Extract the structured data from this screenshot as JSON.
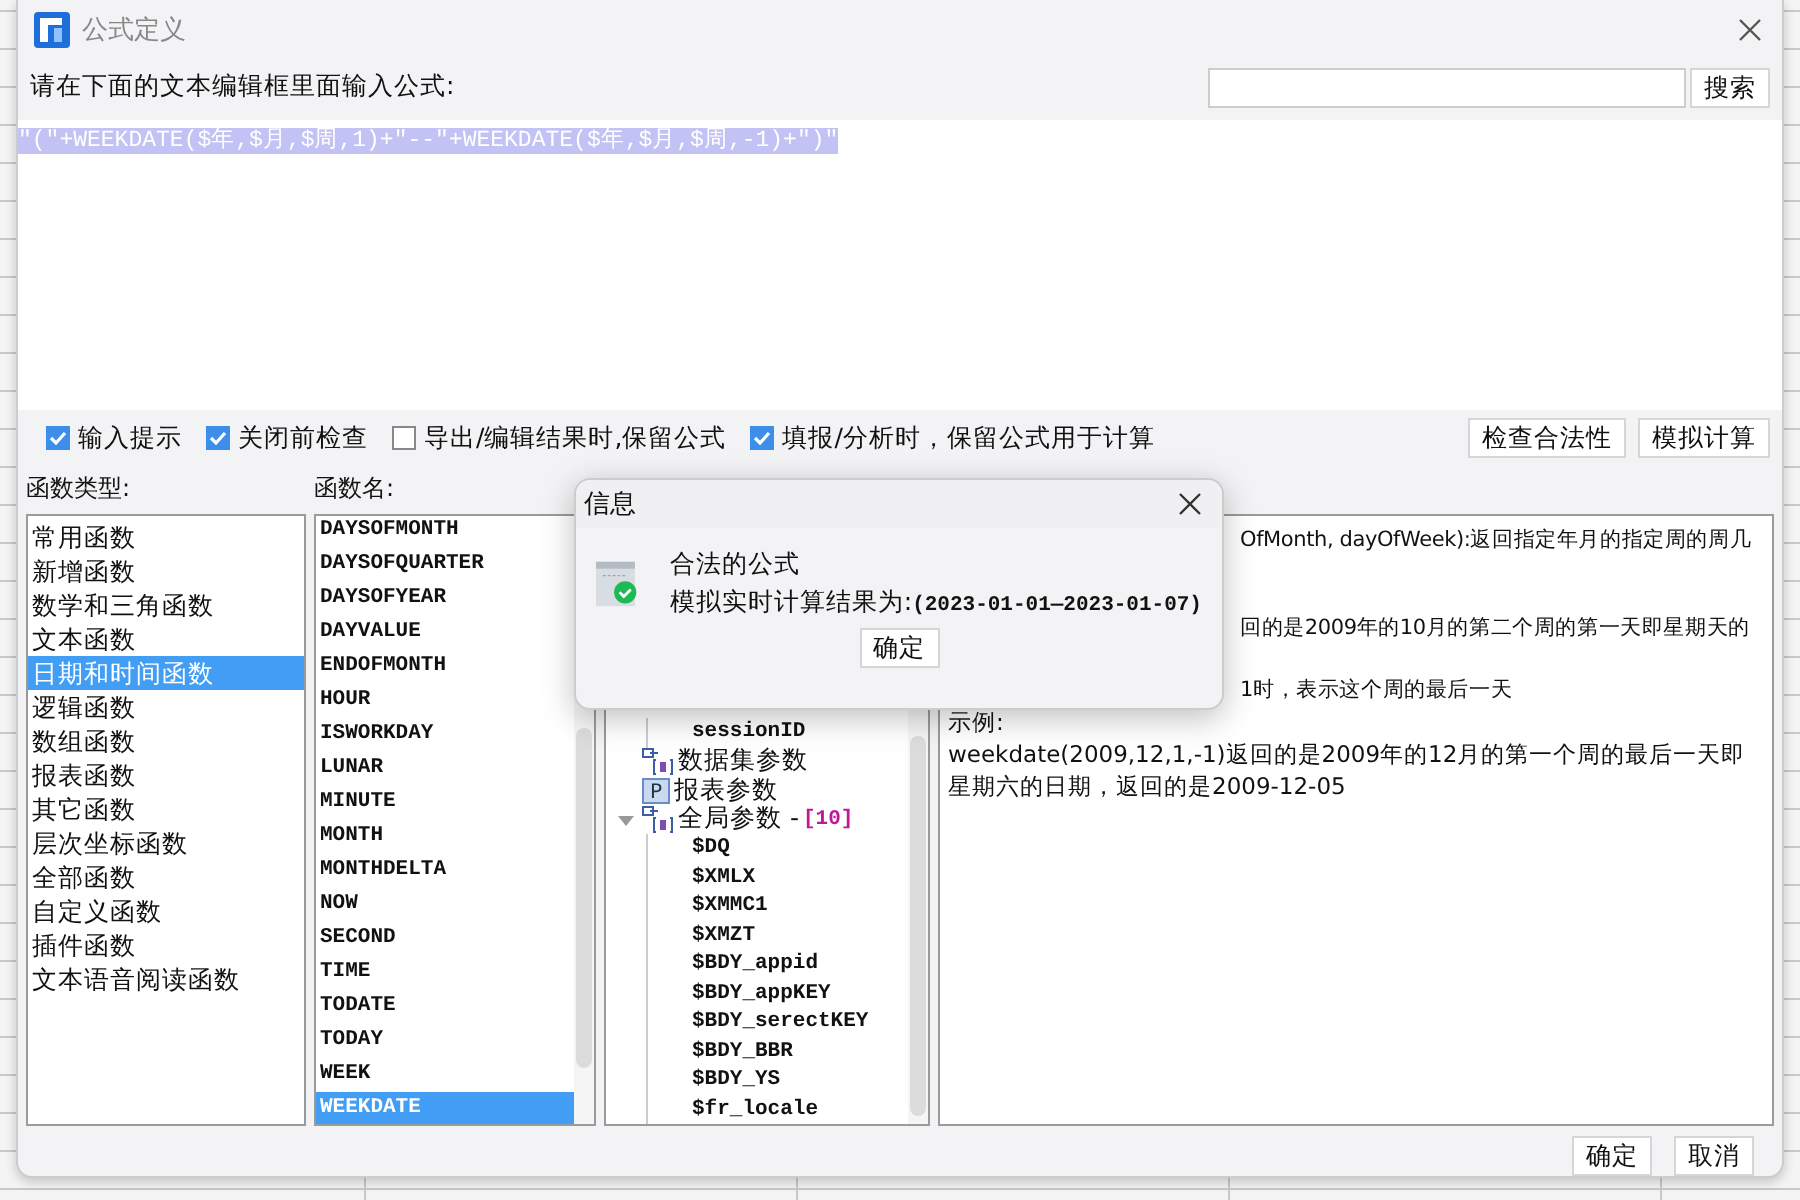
{
  "window": {
    "title": "公式定义"
  },
  "prompt": "请在下面的文本编辑框里面输入公式:",
  "search": {
    "button": "搜索"
  },
  "editor": {
    "formula": "\"(\"+WEEKDATE($年,$月,$周,1)+\"--\"+WEEKDATE($年,$月,$周,-1)+\")\"",
    "selected": true
  },
  "options": [
    {
      "label": "输入提示",
      "checked": true
    },
    {
      "label": "关闭前检查",
      "checked": true
    },
    {
      "label": "导出/编辑结果时,保留公式",
      "checked": false
    },
    {
      "label": "填报/分析时，保留公式用于计算",
      "checked": true
    }
  ],
  "actions": [
    "检查合法性",
    "模拟计算"
  ],
  "category_panel": {
    "label": "函数类型:",
    "items": [
      {
        "label": "常用函数",
        "selected": false
      },
      {
        "label": "新增函数",
        "selected": false
      },
      {
        "label": "数学和三角函数",
        "selected": false
      },
      {
        "label": "文本函数",
        "selected": false
      },
      {
        "label": "日期和时间函数",
        "selected": true
      },
      {
        "label": "逻辑函数",
        "selected": false
      },
      {
        "label": "数组函数",
        "selected": false
      },
      {
        "label": "报表函数",
        "selected": false
      },
      {
        "label": "其它函数",
        "selected": false
      },
      {
        "label": "层次坐标函数",
        "selected": false
      },
      {
        "label": "全部函数",
        "selected": false
      },
      {
        "label": "自定义函数",
        "selected": false
      },
      {
        "label": "插件函数",
        "selected": false
      },
      {
        "label": "文本语音阅读函数",
        "selected": false
      }
    ]
  },
  "function_panel": {
    "label": "函数名:",
    "items": [
      {
        "label": "DAYSOFMONTH",
        "selected": false
      },
      {
        "label": "DAYSOFQUARTER",
        "selected": false
      },
      {
        "label": "DAYSOFYEAR",
        "selected": false
      },
      {
        "label": "DAYVALUE",
        "selected": false
      },
      {
        "label": "ENDOFMONTH",
        "selected": false
      },
      {
        "label": "HOUR",
        "selected": false
      },
      {
        "label": "ISWORKDAY",
        "selected": false
      },
      {
        "label": "LUNAR",
        "selected": false
      },
      {
        "label": "MINUTE",
        "selected": false
      },
      {
        "label": "MONTH",
        "selected": false
      },
      {
        "label": "MONTHDELTA",
        "selected": false
      },
      {
        "label": "NOW",
        "selected": false
      },
      {
        "label": "SECOND",
        "selected": false
      },
      {
        "label": "TIME",
        "selected": false
      },
      {
        "label": "TODATE",
        "selected": false
      },
      {
        "label": "TODAY",
        "selected": false
      },
      {
        "label": "WEEK",
        "selected": false
      },
      {
        "label": "WEEKDATE",
        "selected": true
      }
    ]
  },
  "parameter_tree": {
    "nodes": [
      {
        "children": [
          {
            "label": "sessionID",
            "kind": "leaf"
          }
        ]
      },
      {
        "label": "数据集参数",
        "kind": "group"
      },
      {
        "label": "报表参数",
        "kind": "report",
        "icon_letter": "P"
      },
      {
        "label": "全局参数 - ",
        "count": "[10]",
        "kind": "group",
        "expanded": true,
        "children": [
          {
            "label": "$DQ",
            "kind": "leaf"
          },
          {
            "label": "$XMLX",
            "kind": "leaf"
          },
          {
            "label": "$XMMC1",
            "kind": "leaf"
          },
          {
            "label": "$XMZT",
            "kind": "leaf"
          },
          {
            "label": "$BDY_appid",
            "kind": "leaf"
          },
          {
            "label": "$BDY_appKEY",
            "kind": "leaf"
          },
          {
            "label": "$BDY_serectKEY",
            "kind": "leaf"
          },
          {
            "label": "$BDY_BBR",
            "kind": "leaf"
          },
          {
            "label": "$BDY_YS",
            "kind": "leaf"
          },
          {
            "label": "$fr_locale",
            "kind": "leaf"
          }
        ]
      }
    ]
  },
  "description": {
    "lines": [
      {
        "text": "OfMonth, dayOfWeek):返回指定年月的指定周的周几",
        "clipped": true
      },
      {
        "text": "回的是2009年的10月的第二个周的第一天即星期天的",
        "clipped": true
      },
      {
        "text": "1时，表示这个周的最后一天",
        "clipped": true
      },
      {
        "text": "示例:",
        "clipped": false
      },
      {
        "text": "weekdate(2009,12,1,-1)返回的是2009年的12月的第一个周的最后一天即星期六的日期，返回的是2009-12-05",
        "clipped": false
      }
    ]
  },
  "footer_buttons": [
    "确定",
    "取消"
  ],
  "message_dialog": {
    "title": "信息",
    "heading": "合法的公式",
    "result_label": "模拟实时计算结果为:",
    "result_value": "(2023-01-01—2023-01-07)",
    "button": "确定"
  }
}
